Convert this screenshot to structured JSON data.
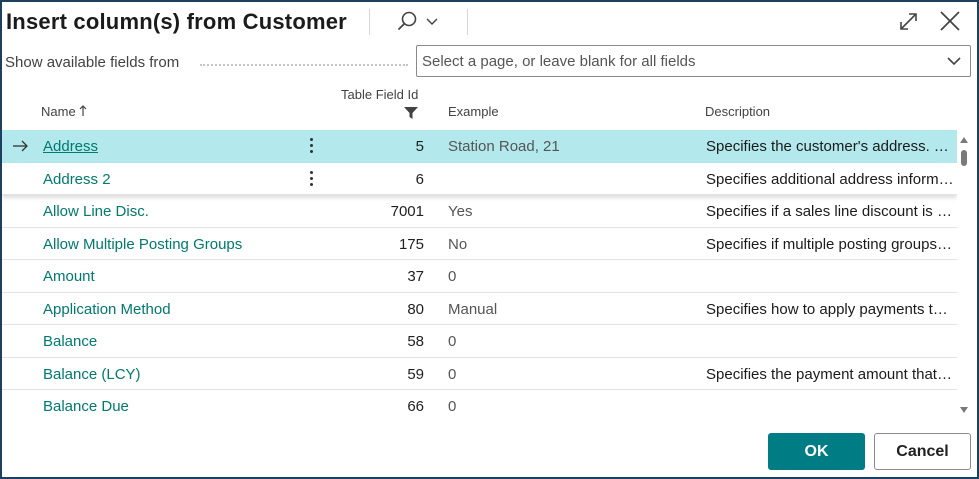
{
  "dialog": {
    "title": "Insert column(s) from Customer"
  },
  "filter": {
    "label": "Show available fields from",
    "placeholder": "Select a page, or leave blank for all fields"
  },
  "columns": {
    "name": "Name",
    "field_id": "Table Field Id",
    "example": "Example",
    "description": "Description"
  },
  "rows": [
    {
      "name": "Address",
      "id": "5",
      "example": "Station Road, 21",
      "description": "Specifies the customer's address. This address will appear on all sales documents for the customer."
    },
    {
      "name": "Address 2",
      "id": "6",
      "example": "",
      "description": "Specifies additional address information."
    },
    {
      "name": "Allow Line Disc.",
      "id": "7001",
      "example": "Yes",
      "description": "Specifies if a sales line discount is calculated."
    },
    {
      "name": "Allow Multiple Posting Groups",
      "id": "175",
      "example": "No",
      "description": "Specifies if multiple posting groups can be used."
    },
    {
      "name": "Amount",
      "id": "37",
      "example": "0",
      "description": ""
    },
    {
      "name": "Application Method",
      "id": "80",
      "example": "Manual",
      "description": "Specifies how to apply payments to entries for this customer."
    },
    {
      "name": "Balance",
      "id": "58",
      "example": "0",
      "description": ""
    },
    {
      "name": "Balance (LCY)",
      "id": "59",
      "example": "0",
      "description": "Specifies the payment amount that the customer owes for completed sales."
    },
    {
      "name": "Balance Due",
      "id": "66",
      "example": "0",
      "description": ""
    }
  ],
  "buttons": {
    "ok": "OK",
    "cancel": "Cancel"
  },
  "colors": {
    "accent": "#007c84",
    "link": "#00796f",
    "selected_row": "#b3e9ec",
    "border": "#1f3f5f"
  },
  "icons": [
    "search-icon",
    "chevron-down-icon",
    "expand-icon",
    "close-icon",
    "sort-ascending-icon",
    "filter-icon",
    "row-arrow-icon",
    "more-options-icon"
  ]
}
